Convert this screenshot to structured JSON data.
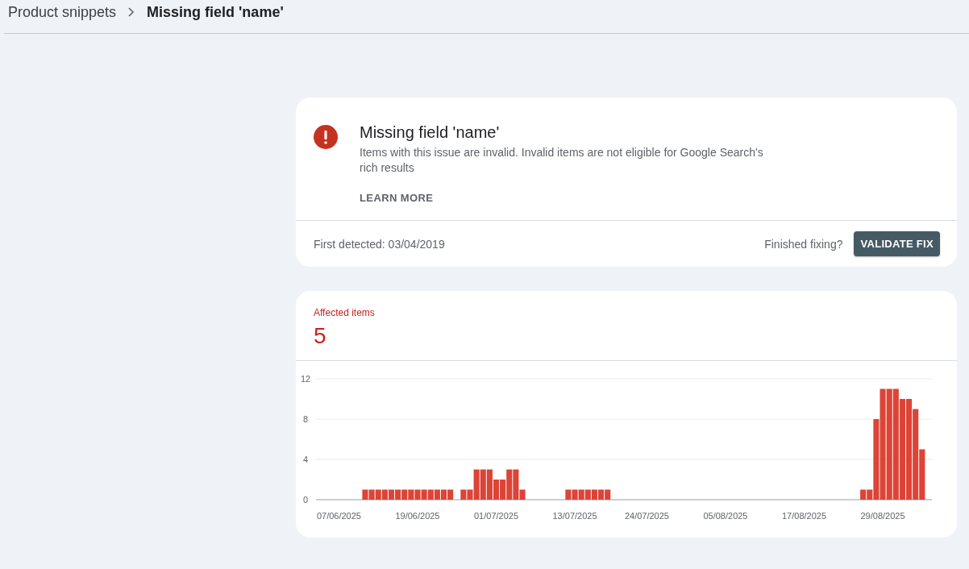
{
  "breadcrumb": [
    {
      "label": "Product snippets",
      "current": false
    },
    {
      "label": "Missing field 'name'",
      "current": true
    }
  ],
  "issue": {
    "title": "Missing field 'name'",
    "description": "Items with this issue are invalid. Invalid items are not eligible for Google Search's rich results",
    "learn_more": "LEARN MORE",
    "first_detected": "First detected: 03/04/2019",
    "finished_prompt": "Finished fixing?",
    "validate_button": "VALIDATE FIX"
  },
  "affected": {
    "label": "Affected items",
    "count": "5",
    "chart_data": {
      "type": "bar",
      "categories": [
        null,
        null,
        null,
        "07/06/2025",
        null,
        null,
        null,
        null,
        null,
        null,
        null,
        null,
        null,
        null,
        null,
        "19/06/2025",
        null,
        null,
        null,
        null,
        null,
        null,
        null,
        null,
        null,
        null,
        null,
        "01/07/2025",
        null,
        null,
        null,
        null,
        null,
        null,
        null,
        null,
        null,
        null,
        null,
        "13/07/2025",
        null,
        null,
        null,
        null,
        null,
        null,
        null,
        null,
        null,
        null,
        "24/07/2025",
        null,
        null,
        null,
        null,
        null,
        null,
        null,
        null,
        null,
        null,
        null,
        "05/08/2025",
        null,
        null,
        null,
        null,
        null,
        null,
        null,
        null,
        null,
        null,
        null,
        "17/08/2025",
        null,
        null,
        null,
        null,
        null,
        null,
        null,
        null,
        null,
        null,
        null,
        "29/08/2025",
        null,
        null,
        null,
        null,
        null,
        null,
        null
      ],
      "series": [
        {
          "color": "#db4437",
          "values": [
            0,
            0,
            0,
            0,
            0,
            0,
            0,
            1,
            1,
            1,
            1,
            1,
            1,
            1,
            1,
            1,
            1,
            1,
            1,
            1,
            1,
            0,
            1,
            1,
            3,
            3,
            3,
            2,
            2,
            3,
            3,
            1,
            0,
            0,
            0,
            0,
            0,
            0,
            1,
            1,
            1,
            1,
            1,
            1,
            1,
            0,
            0,
            0,
            0,
            0,
            0,
            0,
            0,
            0,
            0,
            0,
            0,
            0,
            0,
            0,
            0,
            0,
            0,
            0,
            0,
            0,
            0,
            0,
            0,
            0,
            0,
            0,
            0,
            0,
            0,
            0,
            0,
            0,
            0,
            0,
            0,
            0,
            0,
            1,
            1,
            8,
            11,
            11,
            11,
            10,
            10,
            9,
            5,
            0
          ]
        }
      ],
      "ylim": [
        0,
        12
      ],
      "yticks": [
        0,
        4,
        8,
        12
      ]
    }
  }
}
